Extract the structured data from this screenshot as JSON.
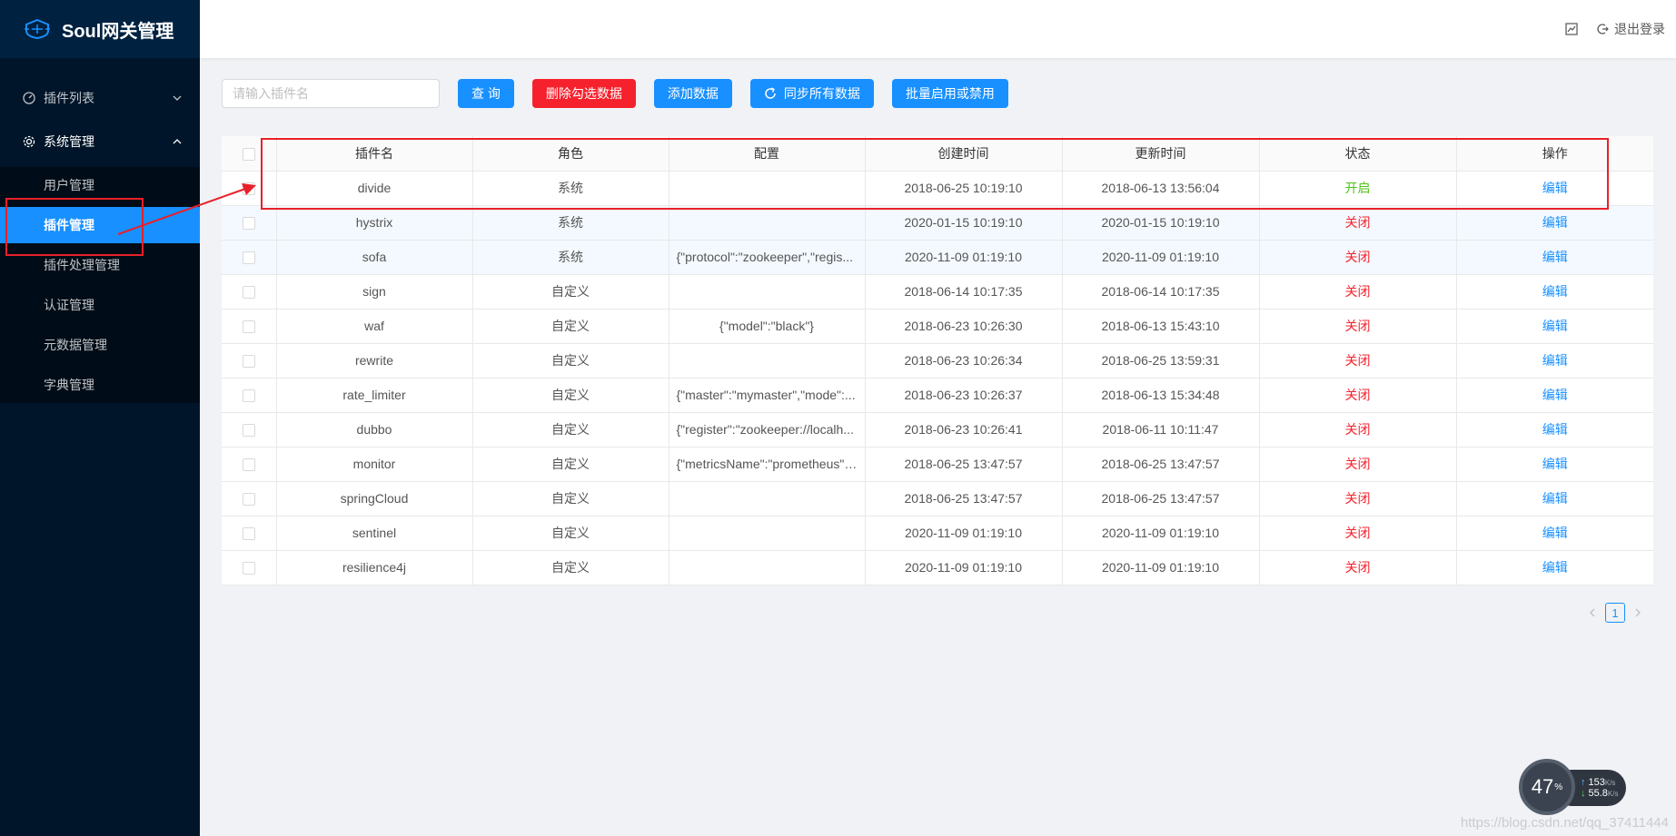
{
  "app": {
    "title": "Soul网关管理"
  },
  "sidebar": {
    "groups": [
      {
        "label": "插件列表",
        "icon": "dashboard-icon",
        "expanded": false
      },
      {
        "label": "系统管理",
        "icon": "gear-icon",
        "expanded": true,
        "items": [
          {
            "label": "用户管理"
          },
          {
            "label": "插件管理",
            "active": true
          },
          {
            "label": "插件处理管理"
          },
          {
            "label": "认证管理"
          },
          {
            "label": "元数据管理"
          },
          {
            "label": "字典管理"
          }
        ]
      }
    ]
  },
  "header": {
    "logout_label": "退出登录"
  },
  "toolbar": {
    "search_placeholder": "请输入插件名",
    "query_label": "查 询",
    "delete_label": "删除勾选数据",
    "add_label": "添加数据",
    "sync_label": "同步所有数据",
    "batch_label": "批量启用或禁用"
  },
  "table": {
    "columns": [
      "插件名",
      "角色",
      "配置",
      "创建时间",
      "更新时间",
      "状态",
      "操作"
    ],
    "rows": [
      {
        "name": "divide",
        "role": "系统",
        "config": "",
        "created": "2018-06-25 10:19:10",
        "updated": "2018-06-13 13:56:04",
        "status": "开启",
        "action": "编辑"
      },
      {
        "name": "hystrix",
        "role": "系统",
        "config": "",
        "created": "2020-01-15 10:19:10",
        "updated": "2020-01-15 10:19:10",
        "status": "关闭",
        "action": "编辑"
      },
      {
        "name": "sofa",
        "role": "系统",
        "config": "{\"protocol\":\"zookeeper\",\"regis...",
        "created": "2020-11-09 01:19:10",
        "updated": "2020-11-09 01:19:10",
        "status": "关闭",
        "action": "编辑"
      },
      {
        "name": "sign",
        "role": "自定义",
        "config": "",
        "created": "2018-06-14 10:17:35",
        "updated": "2018-06-14 10:17:35",
        "status": "关闭",
        "action": "编辑"
      },
      {
        "name": "waf",
        "role": "自定义",
        "config": "{\"model\":\"black\"}",
        "created": "2018-06-23 10:26:30",
        "updated": "2018-06-13 15:43:10",
        "status": "关闭",
        "action": "编辑"
      },
      {
        "name": "rewrite",
        "role": "自定义",
        "config": "",
        "created": "2018-06-23 10:26:34",
        "updated": "2018-06-25 13:59:31",
        "status": "关闭",
        "action": "编辑"
      },
      {
        "name": "rate_limiter",
        "role": "自定义",
        "config": "{\"master\":\"mymaster\",\"mode\":...",
        "created": "2018-06-23 10:26:37",
        "updated": "2018-06-13 15:34:48",
        "status": "关闭",
        "action": "编辑"
      },
      {
        "name": "dubbo",
        "role": "自定义",
        "config": "{\"register\":\"zookeeper://localh...",
        "created": "2018-06-23 10:26:41",
        "updated": "2018-06-11 10:11:47",
        "status": "关闭",
        "action": "编辑"
      },
      {
        "name": "monitor",
        "role": "自定义",
        "config": "{\"metricsName\":\"prometheus\",...",
        "created": "2018-06-25 13:47:57",
        "updated": "2018-06-25 13:47:57",
        "status": "关闭",
        "action": "编辑"
      },
      {
        "name": "springCloud",
        "role": "自定义",
        "config": "",
        "created": "2018-06-25 13:47:57",
        "updated": "2018-06-25 13:47:57",
        "status": "关闭",
        "action": "编辑"
      },
      {
        "name": "sentinel",
        "role": "自定义",
        "config": "",
        "created": "2020-11-09 01:19:10",
        "updated": "2020-11-09 01:19:10",
        "status": "关闭",
        "action": "编辑"
      },
      {
        "name": "resilience4j",
        "role": "自定义",
        "config": "",
        "created": "2020-11-09 01:19:10",
        "updated": "2020-11-09 01:19:10",
        "status": "关闭",
        "action": "编辑"
      }
    ]
  },
  "pagination": {
    "current": "1"
  },
  "speed_widget": {
    "percent": "47",
    "percent_unit": "%",
    "up": "153",
    "up_unit": "K/s",
    "down": "55.8",
    "down_unit": "K/s"
  },
  "watermark": "https://blog.csdn.net/qq_37411444",
  "colors": {
    "sidebar_bg": "#001529",
    "primary": "#1890ff",
    "danger": "#f5222d",
    "success": "#52c41a",
    "annotation": "#e8202a"
  }
}
